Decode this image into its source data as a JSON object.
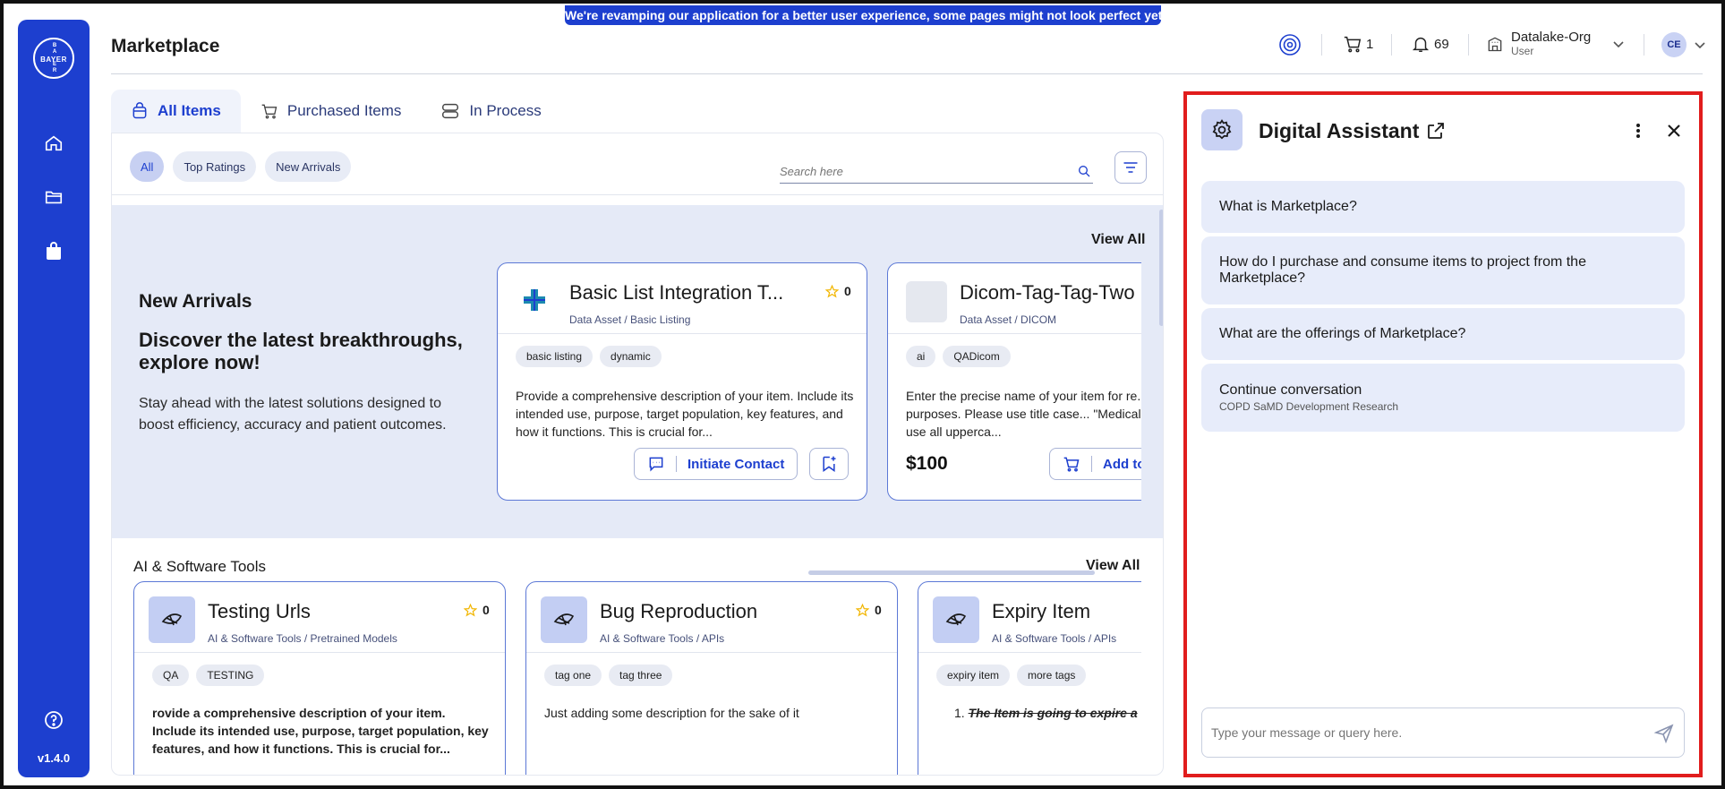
{
  "banner": {
    "text": "We're revamping our application for a better user experience, some pages might not look perfect yet!"
  },
  "sidebar": {
    "logo": {
      "h": "BAYER",
      "v": [
        "B",
        "A",
        "Y",
        "E",
        "R"
      ]
    },
    "version": "v1.4.0",
    "icons": [
      "home-icon",
      "folder-icon",
      "shopping-bag-icon",
      "help-icon"
    ]
  },
  "header": {
    "title": "Marketplace",
    "cart_count": "1",
    "notification_count": "69",
    "org_name": "Datalake-Org",
    "org_role": "User",
    "avatar_initials": "CE"
  },
  "tabs": [
    {
      "label": "All Items",
      "active": true
    },
    {
      "label": "Purchased Items",
      "active": false
    },
    {
      "label": "In Process",
      "active": false
    }
  ],
  "filters": [
    "All",
    "Top Ratings",
    "New Arrivals"
  ],
  "search": {
    "placeholder": "Search here"
  },
  "new_arrivals": {
    "title": "New Arrivals",
    "headline": "Discover the latest breakthroughs, explore now!",
    "description": "Stay ahead with the latest solutions designed to boost efficiency, accuracy and patient outcomes.",
    "view_all": "View All",
    "cards": [
      {
        "title": "Basic List Integration T...",
        "subtitle": "Data Asset / Basic Listing",
        "rating": "0",
        "tags": [
          "basic listing",
          "dynamic"
        ],
        "description": "Provide a comprehensive description of your item. Include its intended use, purpose, target population, key features, and how it functions. This is crucial for...",
        "action": "Initiate Contact"
      },
      {
        "title": "Dicom-Tag-Tag-Two",
        "subtitle": "Data Asset / DICOM",
        "tags": [
          "ai",
          "QADicom"
        ],
        "description": "Enter the precise name of your item for re... marketing purposes. Please use title case... \"Medical Device\"). Do not use all upperca...",
        "price": "$100",
        "action": "Add to"
      }
    ]
  },
  "ai_tools": {
    "title": "AI & Software Tools",
    "view_all": "View All",
    "cards": [
      {
        "title": "Testing Urls",
        "subtitle": "AI & Software Tools / Pretrained Models",
        "rating": "0",
        "tags": [
          "QA",
          "TESTING"
        ],
        "description": "rovide a comprehensive description of your item. Include its intended use, purpose, target population, key features, and how it functions. This is crucial for..."
      },
      {
        "title": "Bug Reproduction",
        "subtitle": "AI & Software Tools / APIs",
        "rating": "0",
        "tags": [
          "tag one",
          "tag three"
        ],
        "description": "Just adding some description for the sake of it"
      },
      {
        "title": "Expiry Item",
        "subtitle": "AI & Software Tools / APIs",
        "tags": [
          "expiry item",
          "more tags"
        ],
        "description": "The Item is going to expire a"
      }
    ]
  },
  "assistant": {
    "title": "Digital Assistant",
    "questions": [
      {
        "text": "What is Marketplace?"
      },
      {
        "text": "How do I purchase and consume items to project from the Marketplace?"
      },
      {
        "text": "What are the offerings of Marketplace?"
      },
      {
        "text": "Continue conversation",
        "sub": "COPD SaMD Development Research"
      }
    ],
    "input_placeholder": "Type your message or query here."
  },
  "colors": {
    "brand_blue": "#1d3fcf",
    "highlight_red": "#e11d1d",
    "star": "#f2b705"
  }
}
